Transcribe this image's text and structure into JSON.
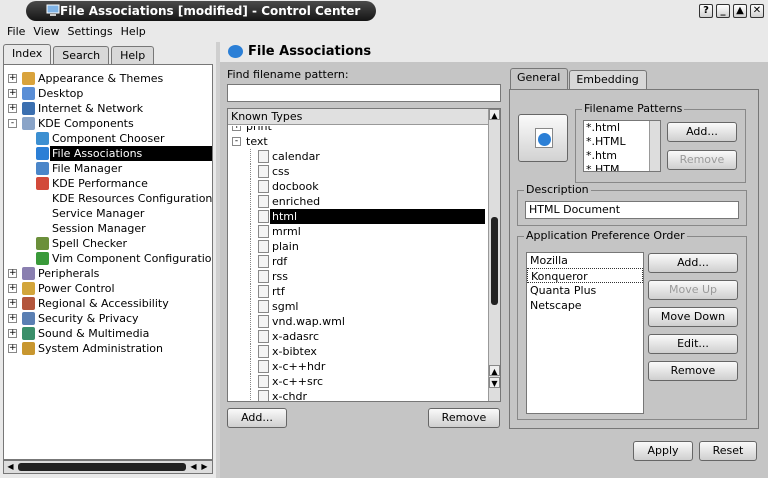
{
  "window": {
    "title": "File Associations [modified] - Control Center",
    "buttons": [
      "?",
      "_",
      "▲",
      "✕"
    ]
  },
  "menubar": [
    "File",
    "View",
    "Settings",
    "Help"
  ],
  "left_tabs": [
    "Index",
    "Search",
    "Help"
  ],
  "tree": [
    {
      "label": "Appearance & Themes",
      "level": 0,
      "expander": "+",
      "icon": "appearance-icon"
    },
    {
      "label": "Desktop",
      "level": 0,
      "expander": "+",
      "icon": "desktop-icon"
    },
    {
      "label": "Internet & Network",
      "level": 0,
      "expander": "+",
      "icon": "network-icon"
    },
    {
      "label": "KDE Components",
      "level": 0,
      "expander": "-",
      "icon": "kde-components-icon"
    },
    {
      "label": "Component Chooser",
      "level": 1,
      "icon": "component-chooser-icon"
    },
    {
      "label": "File Associations",
      "level": 1,
      "icon": "file-associations-icon",
      "selected": true
    },
    {
      "label": "File Manager",
      "level": 1,
      "icon": "file-manager-icon"
    },
    {
      "label": "KDE Performance",
      "level": 1,
      "icon": "performance-icon"
    },
    {
      "label": "KDE Resources Configuration",
      "level": 1,
      "icon": ""
    },
    {
      "label": "Service Manager",
      "level": 1,
      "icon": ""
    },
    {
      "label": "Session Manager",
      "level": 1,
      "icon": ""
    },
    {
      "label": "Spell Checker",
      "level": 1,
      "icon": "spell-checker-icon"
    },
    {
      "label": "Vim Component Configuration",
      "level": 1,
      "icon": "vim-icon"
    },
    {
      "label": "Peripherals",
      "level": 0,
      "expander": "+",
      "icon": "peripherals-icon"
    },
    {
      "label": "Power Control",
      "level": 0,
      "expander": "+",
      "icon": "power-icon"
    },
    {
      "label": "Regional & Accessibility",
      "level": 0,
      "expander": "+",
      "icon": "regional-icon"
    },
    {
      "label": "Security & Privacy",
      "level": 0,
      "expander": "+",
      "icon": "security-icon"
    },
    {
      "label": "Sound & Multimedia",
      "level": 0,
      "expander": "+",
      "icon": "sound-icon"
    },
    {
      "label": "System Administration",
      "level": 0,
      "expander": "+",
      "icon": "system-admin-icon"
    }
  ],
  "main": {
    "title": "File Associations",
    "pattern_label": "Find filename pattern:",
    "pattern_value": "",
    "known_types_header": "Known Types",
    "types": [
      {
        "label": "print",
        "level": 0,
        "expander": "+"
      },
      {
        "label": "text",
        "level": 0,
        "expander": "-"
      },
      {
        "label": "calendar",
        "level": 1
      },
      {
        "label": "css",
        "level": 1
      },
      {
        "label": "docbook",
        "level": 1
      },
      {
        "label": "enriched",
        "level": 1
      },
      {
        "label": "html",
        "level": 1,
        "selected": true
      },
      {
        "label": "mrml",
        "level": 1
      },
      {
        "label": "plain",
        "level": 1
      },
      {
        "label": "rdf",
        "level": 1
      },
      {
        "label": "rss",
        "level": 1
      },
      {
        "label": "rtf",
        "level": 1
      },
      {
        "label": "sgml",
        "level": 1
      },
      {
        "label": "vnd.wap.wml",
        "level": 1
      },
      {
        "label": "x-adasrc",
        "level": 1
      },
      {
        "label": "x-bibtex",
        "level": 1
      },
      {
        "label": "x-c++hdr",
        "level": 1
      },
      {
        "label": "x-c++src",
        "level": 1
      },
      {
        "label": "x-chdr",
        "level": 1
      }
    ],
    "add_button": "Add...",
    "remove_button": "Remove",
    "tabs": [
      "General",
      "Embedding"
    ],
    "filename_patterns": {
      "title": "Filename Patterns",
      "items": [
        "*.html",
        "*.HTML",
        "*.htm",
        "*.HTM"
      ],
      "add_button": "Add...",
      "remove_button": "Remove"
    },
    "description": {
      "title": "Description",
      "value": "HTML Document"
    },
    "app_pref": {
      "title": "Application Preference Order",
      "items": [
        "Mozilla",
        "Konqueror",
        "Quanta Plus",
        "Netscape"
      ],
      "add_button": "Add...",
      "move_up_button": "Move Up",
      "move_down_button": "Move Down",
      "edit_button": "Edit...",
      "remove_button": "Remove"
    },
    "apply_button": "Apply",
    "reset_button": "Reset"
  }
}
